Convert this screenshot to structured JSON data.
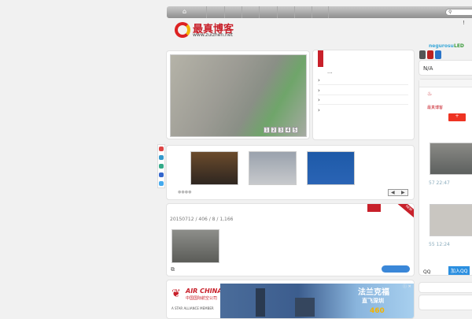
{
  "nav": {
    "home_icon": "home-icon",
    "search_icon": "search-icon",
    "top_right_mark": "!"
  },
  "logo": {
    "text": "最真博客",
    "url": "www.zuizhen.net"
  },
  "user": {
    "name": "negurosu",
    "tag": "LED",
    "status": "N/A"
  },
  "slider": {
    "pages": [
      "1",
      "2",
      "3",
      "4",
      "5"
    ]
  },
  "list": {
    "ellipsis": "..."
  },
  "gallery": {
    "dots": "●●●●",
    "prev": "◀",
    "next": "▶"
  },
  "post": {
    "meta": "20150712 / 406  / 8 / 1,166",
    "badge": "NEW"
  },
  "sidebar": {
    "items": [
      {
        "time": "57 22:47"
      },
      {
        "time": "55 12:24"
      }
    ],
    "qq_label": "QQ",
    "join_qq": "加入QQ",
    "hot_icon": "fire-icon"
  },
  "ad": {
    "brand": "AIR CHINA",
    "brand_cn": "中国国际航空公司",
    "alliance": "A STAR ALLIANCE MEMBER",
    "headline": "法兰克福",
    "sub": "直飞深圳",
    "price": "460",
    "corner": "ⓘ ✕"
  },
  "colors": {
    "accent": "#c8202a",
    "link": "#3ba8d8",
    "green": "#3a9b3a",
    "button": "#3a87d8"
  }
}
